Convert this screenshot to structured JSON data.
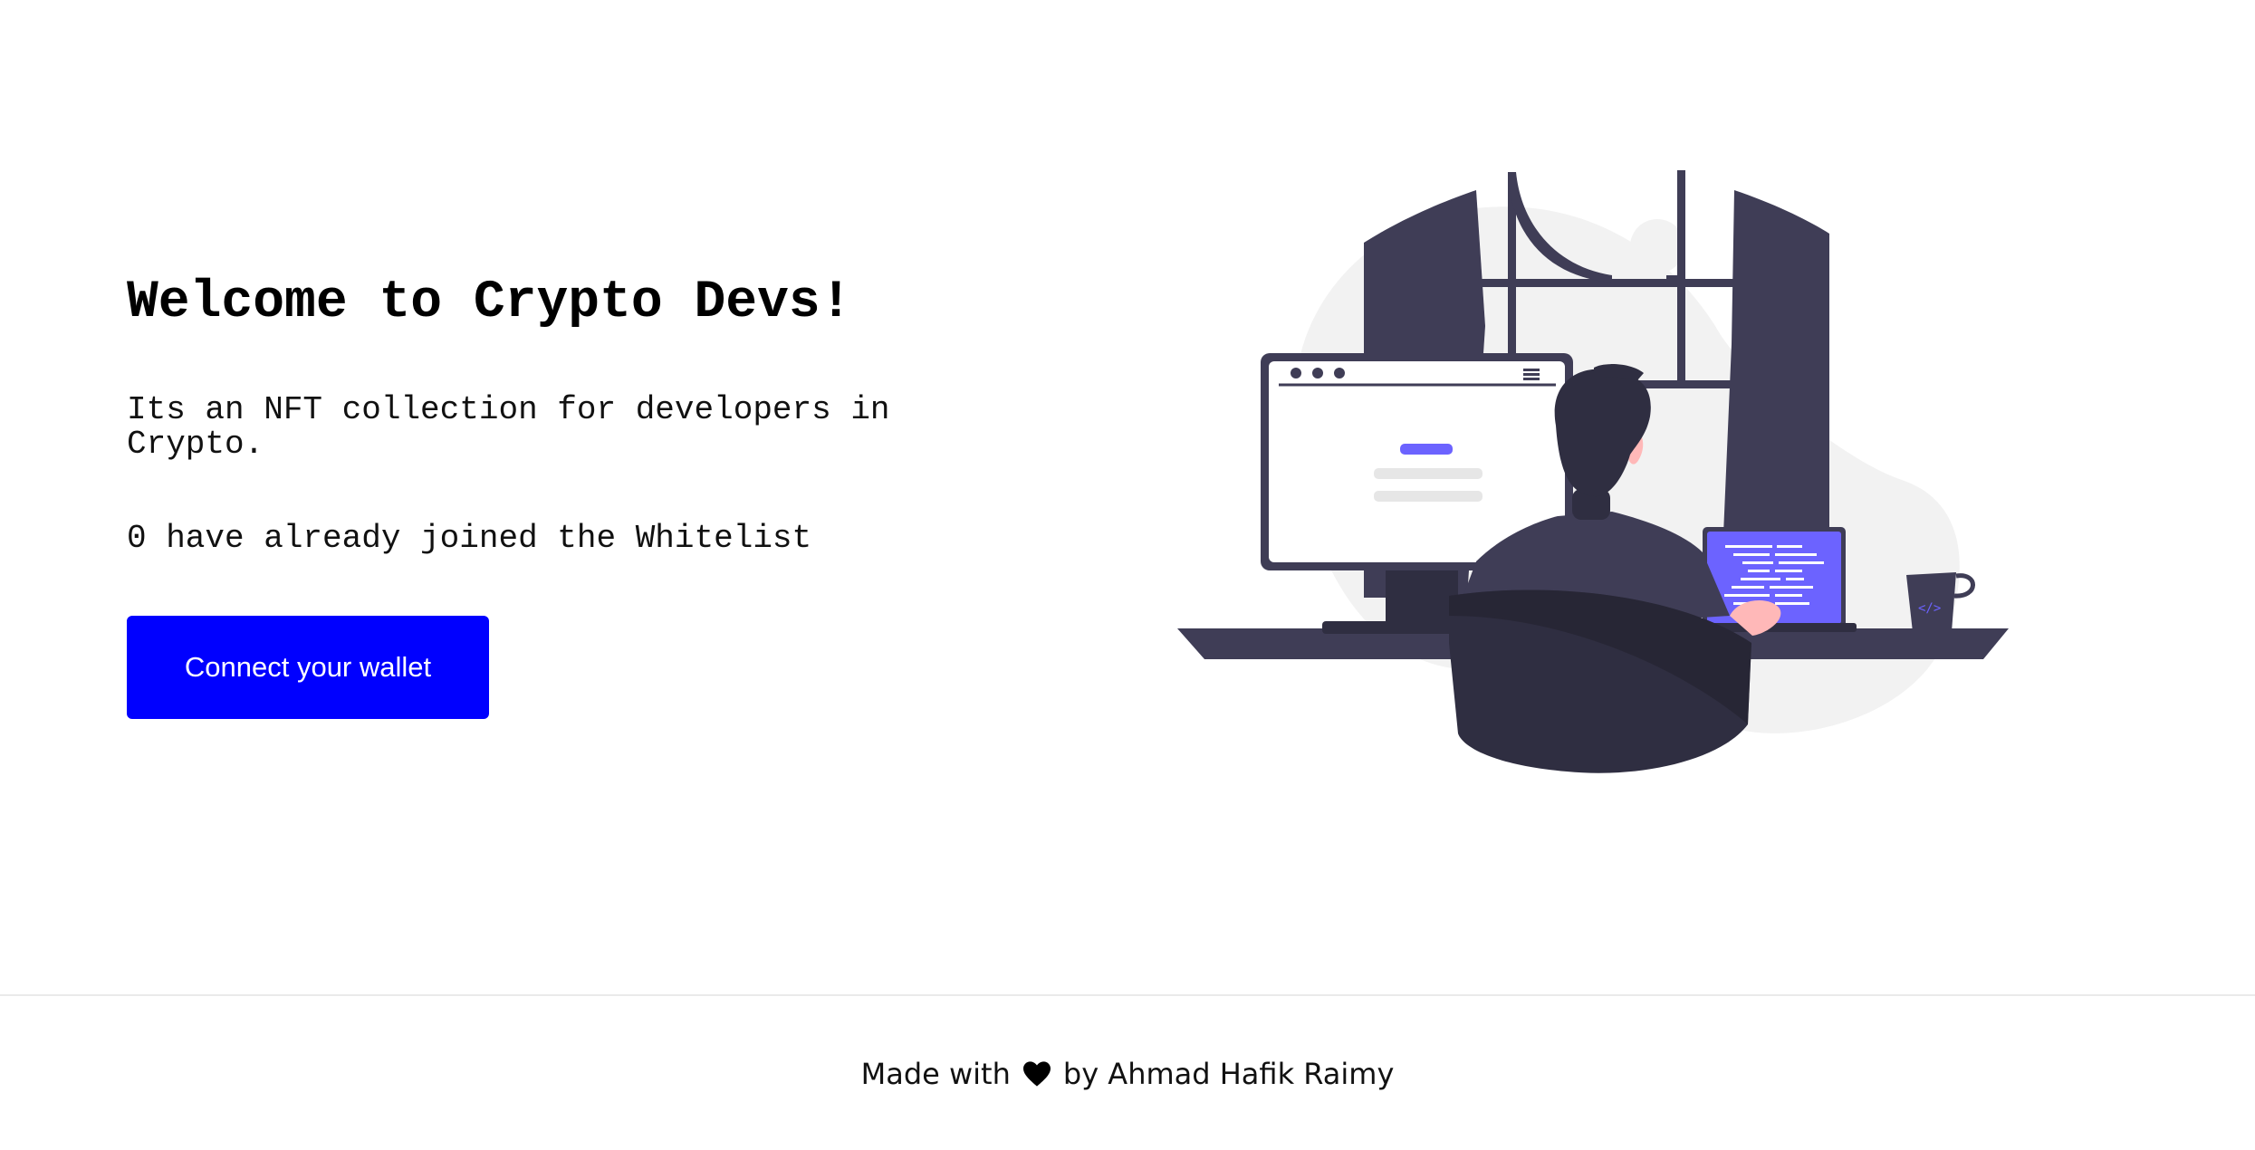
{
  "hero": {
    "title": "Welcome to Crypto Devs!",
    "description": "Its an NFT collection for developers in Crypto.",
    "whitelist_status": "0 have already joined the Whitelist",
    "connect_button_label": "Connect your wallet",
    "button_color": "#0000ff"
  },
  "illustration": {
    "icon": "developer-at-desk-illustration",
    "accent_color": "#6c63ff",
    "dark_color": "#3f3d56"
  },
  "footer": {
    "prefix": "Made with",
    "icon": "heart-icon",
    "suffix": "by Ahmad Hafik Raimy"
  }
}
